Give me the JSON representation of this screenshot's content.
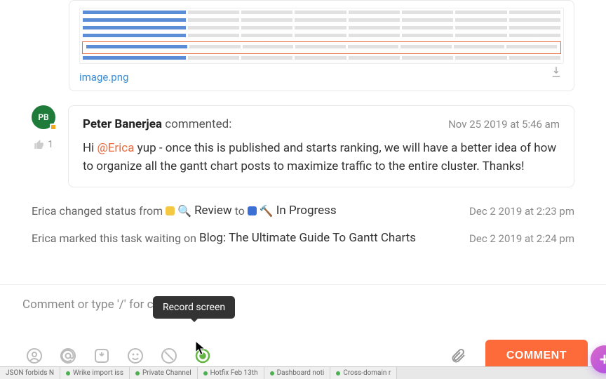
{
  "attachment": {
    "filename": "image.png"
  },
  "comment": {
    "avatar_initials": "PB",
    "author": "Peter Banerjea",
    "action": " commented:",
    "timestamp": "Nov 25 2019 at 5:46 am",
    "like_count": "1",
    "body_prefix": "Hi ",
    "mention": "@Erica",
    "body_rest": " yup - once this is published and starts ranking, we will have a better idea of how to organize all the gantt chart posts to maximize traffic to the entire cluster. Thanks!"
  },
  "activities": [
    {
      "actor": "Erica",
      "verb": "changed status from",
      "from_status": "Review",
      "to_word": "to",
      "to_status": "In Progress",
      "timestamp": "Dec 2 2019 at 2:23 pm",
      "from_color": "#f5c842",
      "to_color": "#3b6fd4"
    },
    {
      "actor": "Erica",
      "verb": "marked this task waiting on",
      "task": "Blog: The Ultimate Guide To Gantt Charts",
      "timestamp": "Dec 2 2019 at 2:24 pm"
    }
  ],
  "composer": {
    "placeholder": "Comment or type '/' for commands",
    "submit_label": "COMMENT"
  },
  "tooltip": {
    "text": "Record screen"
  },
  "tabs": [
    "JSON forbids N",
    "Wrike import iss",
    "Private Channel",
    "Hotfix Feb 13th",
    "Dashboard noti",
    "Cross-domain r"
  ],
  "icons": {
    "mention_person": "mention-person-icon",
    "at": "at-icon",
    "assign": "assign-icon",
    "emoji": "emoji-icon",
    "block": "block-icon",
    "record": "record-screen-icon",
    "attach": "paperclip-icon",
    "download": "download-icon",
    "like": "thumbs-up-icon",
    "magnify": "magnifier-icon",
    "hammer": "hammer-icon"
  }
}
